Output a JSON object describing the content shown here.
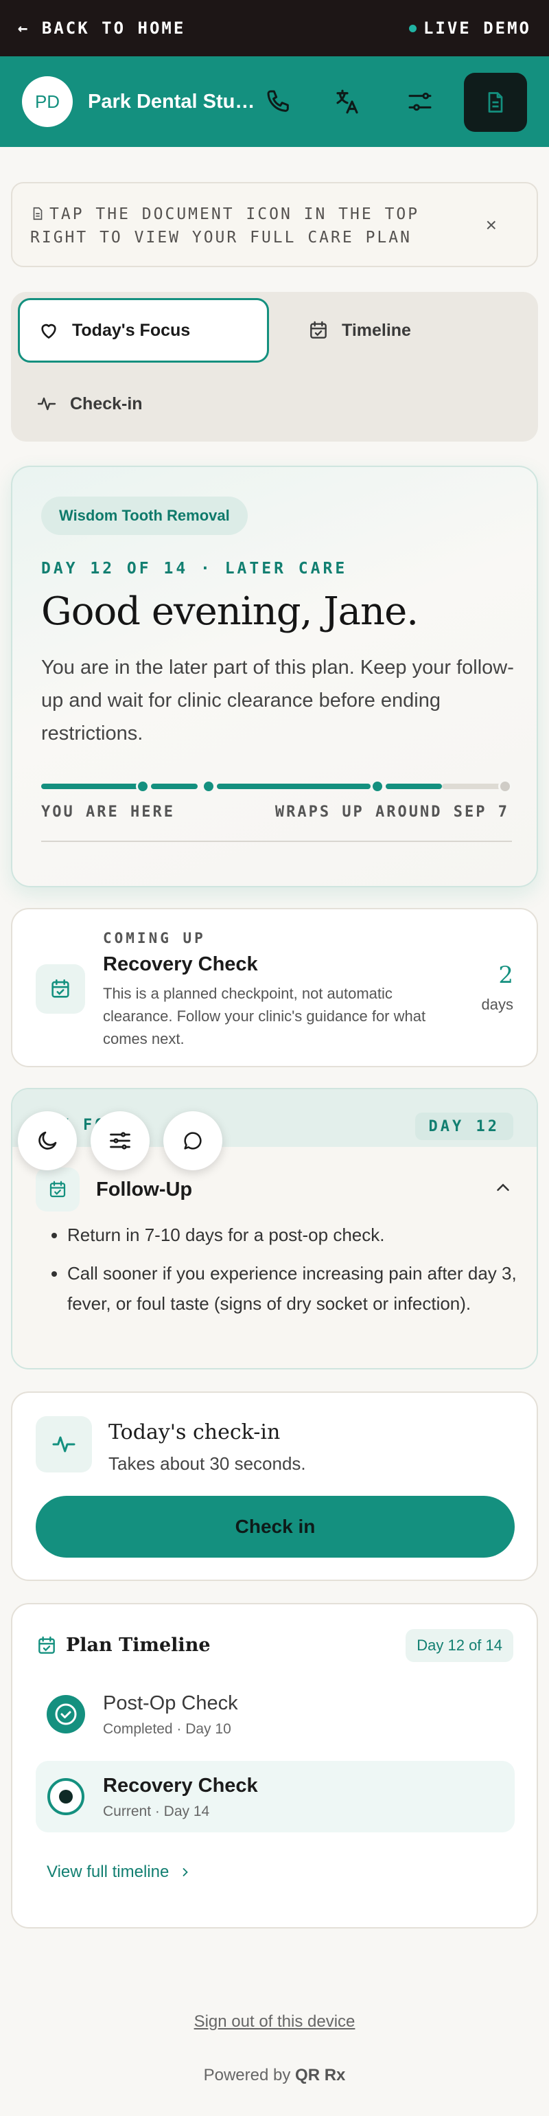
{
  "topbar": {
    "back_label": "← BACK TO HOME",
    "live_label": "LIVE DEMO"
  },
  "header": {
    "avatar_initials": "PD",
    "clinic_name": "Park Dental Studio"
  },
  "banner": {
    "text": "TAP THE DOCUMENT ICON IN THE TOP RIGHT TO VIEW YOUR FULL CARE PLAN",
    "close": "×"
  },
  "tabs": [
    {
      "label": "Today's Focus",
      "active": true
    },
    {
      "label": "Timeline",
      "active": false
    },
    {
      "label": "Check-in",
      "active": false
    }
  ],
  "hero": {
    "procedure": "Wisdom Tooth Removal",
    "day_line": "DAY 12 OF 14 · LATER CARE",
    "greeting": "Good evening, Jane.",
    "message": "You are in the later part of this plan. Keep your follow-up and wait for clinic clearance before ending restrictions.",
    "progress": 0.86,
    "you_are_here": "YOU ARE HERE",
    "wraps_up": "WRAPS UP AROUND SEP 7"
  },
  "coming_up": {
    "kicker": "COMING UP",
    "title": "Recovery Check",
    "description": "This is a planned checkpoint, not automatic clearance. Follow your clinic's guidance for what comes next.",
    "count": "2",
    "unit": "days"
  },
  "follow_up": {
    "kicker": "DAY FOCUS",
    "day_badge": "DAY 12",
    "title": "Follow-Up",
    "items": [
      "Return in 7-10 days for a post-op check.",
      "Call sooner if you experience increasing pain after day 3, fever, or foul taste (signs of dry socket or infection)."
    ]
  },
  "checkin": {
    "title": "Today's check-in",
    "subtitle": "Takes about 30 seconds.",
    "button": "Check in"
  },
  "timeline": {
    "title": "Plan Timeline",
    "badge": "Day 12 of 14",
    "rows": [
      {
        "name": "Post-Op Check",
        "meta": "Completed · Day 10"
      },
      {
        "name": "Recovery Check",
        "meta": "Current · Day 14"
      }
    ],
    "link": "View full timeline"
  },
  "footer": {
    "sign_out": "Sign out of this device",
    "powered_prefix": "Powered by",
    "powered_brand": "QR Rx"
  },
  "colors": {
    "brand": "#14907f",
    "topbar": "#1d1616",
    "background": "#f8f7f4"
  },
  "icons": [
    "phone-icon",
    "translate-icon",
    "sliders-icon",
    "document-icon",
    "heart-icon",
    "calendar-icon",
    "pulse-icon",
    "moon-icon",
    "chat-icon",
    "check-circle-icon",
    "chevron-up-icon",
    "chevron-right-icon"
  ]
}
